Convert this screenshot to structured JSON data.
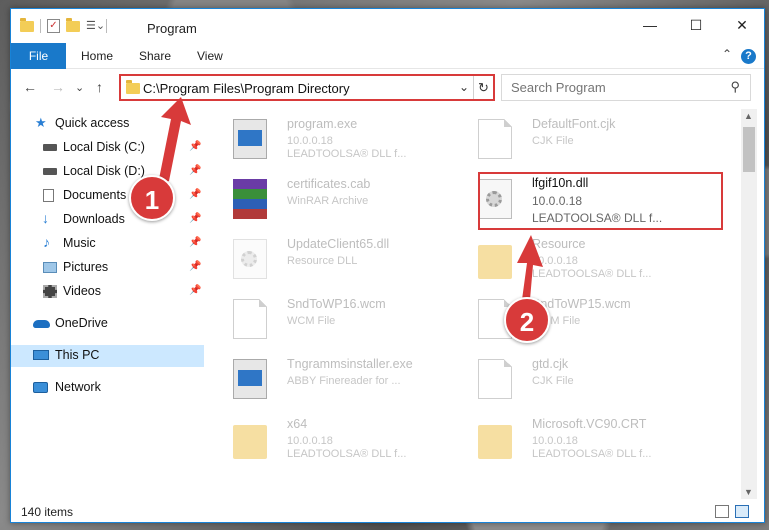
{
  "window": {
    "title": "Program",
    "min_glyph": "—",
    "max_glyph": "☐",
    "close_glyph": "✕"
  },
  "ribbon": {
    "tabs": [
      "File",
      "Home",
      "Share",
      "View"
    ],
    "help_glyph": "?",
    "collapse_glyph": "⌃"
  },
  "nav": {
    "back_glyph": "←",
    "forward_glyph": "→",
    "recent_glyph": "⌄",
    "up_glyph": "↑"
  },
  "address": {
    "path": "C:\\Program Files\\Program Directory",
    "dropdown_glyph": "⌄",
    "refresh_glyph": "↻"
  },
  "search": {
    "placeholder": "Search Program",
    "icon_glyph": "⚲"
  },
  "sidebar": {
    "items": [
      {
        "label": "Quick access",
        "icon": "star-icon",
        "pinned": false
      },
      {
        "label": "Local Disk (C:)",
        "icon": "drive-icon",
        "pinned": true
      },
      {
        "label": "Local Disk (D:)",
        "icon": "drive-icon",
        "pinned": true
      },
      {
        "label": "Documents",
        "icon": "documents-icon",
        "pinned": true
      },
      {
        "label": "Downloads",
        "icon": "download-icon",
        "pinned": true
      },
      {
        "label": "Music",
        "icon": "music-icon",
        "pinned": true
      },
      {
        "label": "Pictures",
        "icon": "pictures-icon",
        "pinned": true
      },
      {
        "label": "Videos",
        "icon": "videos-icon",
        "pinned": true
      },
      {
        "label": "OneDrive",
        "icon": "cloud-icon",
        "pinned": false
      },
      {
        "label": "This PC",
        "icon": "computer-icon",
        "pinned": false,
        "selected": true
      },
      {
        "label": "Network",
        "icon": "network-icon",
        "pinned": false
      }
    ],
    "pin_glyph": "📌"
  },
  "files": [
    {
      "name": "program.exe",
      "line1": "10.0.0.18",
      "line2": "LEADTOOLSA® DLL f...",
      "icon": "program-exe-icon"
    },
    {
      "name": "DefaultFont.cjk",
      "line1": "CJK File",
      "line2": "",
      "icon": "document-icon"
    },
    {
      "name": "certificates.cab",
      "line1": "WinRAR Archive",
      "line2": "",
      "icon": "winrar-archive-icon"
    },
    {
      "name": "lfgif10n.dll",
      "line1": "10.0.0.18",
      "line2": "LEADTOOLSA® DLL f...",
      "icon": "dll-gear-icon",
      "focus": true
    },
    {
      "name": "UpdateClient65.dll",
      "line1": "Resource DLL",
      "line2": "",
      "icon": "dll-gear-icon"
    },
    {
      "name": "Resource",
      "line1": "10.0.0.18",
      "line2": "LEADTOOLSA® DLL f...",
      "icon": "folder-icon"
    },
    {
      "name": "SndToWP16.wcm",
      "line1": "WCM File",
      "line2": "",
      "icon": "document-icon"
    },
    {
      "name": "SndToWP15.wcm",
      "line1": "WCM File",
      "line2": "",
      "icon": "document-icon"
    },
    {
      "name": "Tngrammsinstaller.exe",
      "line1": "ABBY Finereader for ...",
      "line2": "",
      "icon": "installer-exe-icon"
    },
    {
      "name": "gtd.cjk",
      "line1": "CJK File",
      "line2": "",
      "icon": "document-icon"
    },
    {
      "name": "x64",
      "line1": "10.0.0.18",
      "line2": "LEADTOOLSA® DLL f...",
      "icon": "folder-icon"
    },
    {
      "name": "Microsoft.VC90.CRT",
      "line1": "10.0.0.18",
      "line2": "LEADTOOLSA® DLL f...",
      "icon": "folder-icon"
    }
  ],
  "status": {
    "item_count": "140 items"
  },
  "annotations": {
    "badge1": "1",
    "badge2": "2"
  },
  "colors": {
    "accent": "#1979ca",
    "highlight": "#d83a3a",
    "selected": "#cce8ff"
  }
}
